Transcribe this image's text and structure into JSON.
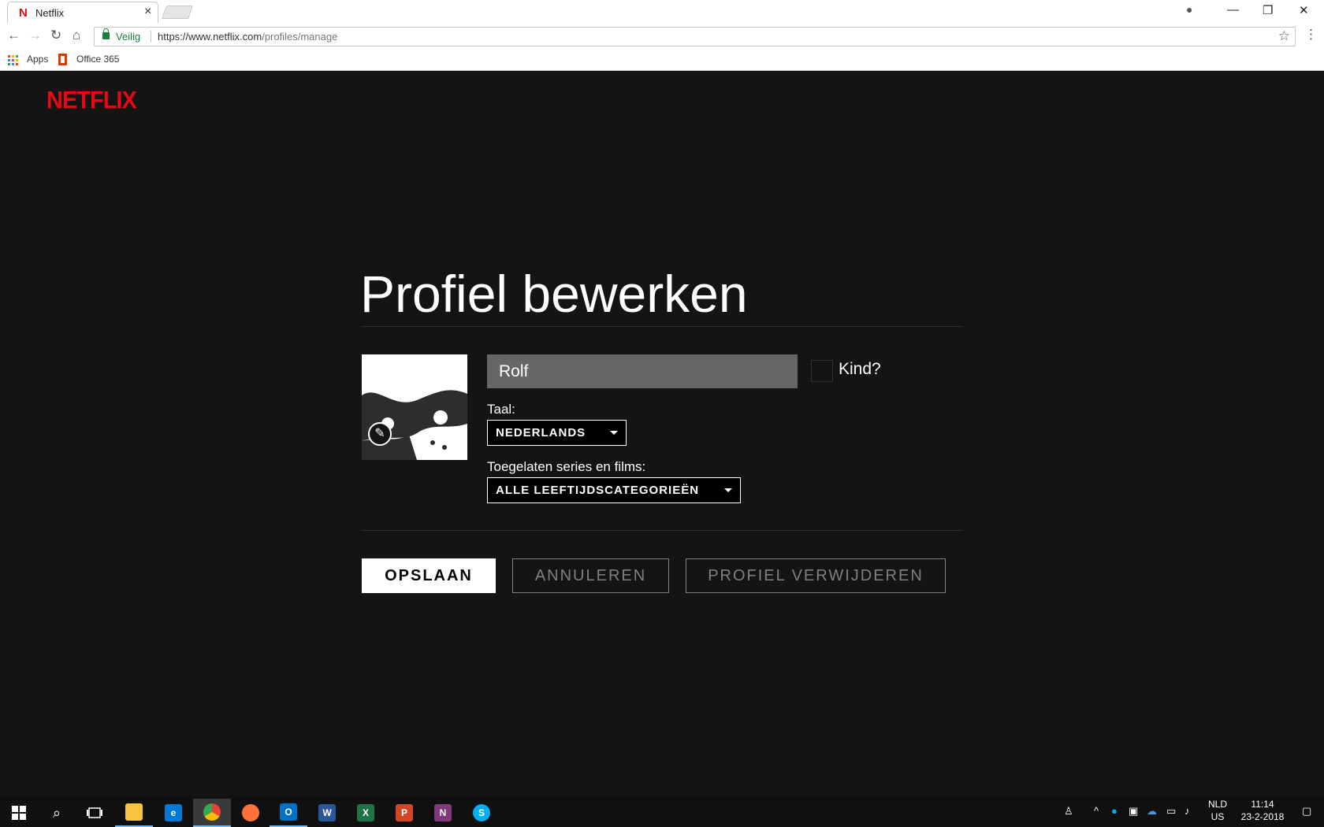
{
  "browser": {
    "tab_title": "Netflix",
    "tab_favicon": "N",
    "security_label": "Veilig",
    "url_host": "https://www.netflix.com",
    "url_path": "/profiles/manage",
    "bookmarks": [
      {
        "label": "Apps",
        "icon": "apps-grid-icon"
      },
      {
        "label": "Office 365",
        "icon": "office365-icon"
      }
    ]
  },
  "netflix": {
    "logo": "NETFLIX",
    "page_title": "Profiel bewerken",
    "profile_name": "Rolf",
    "kid_label": "Kind?",
    "kid_checked": false,
    "language_label": "Taal:",
    "language_value": "NEDERLANDS",
    "maturity_label": "Toegelaten series en films:",
    "maturity_value": "ALLE LEEFTIJDSCATEGORIEËN",
    "save_button": "OPSLAAN",
    "cancel_button": "ANNULEREN",
    "delete_button": "PROFIEL VERWIJDEREN",
    "brand_color": "#e50914"
  },
  "taskbar": {
    "apps": [
      "windows-start-icon",
      "search-icon",
      "task-view-icon",
      "file-explorer-icon",
      "edge-icon",
      "chrome-icon",
      "firefox-icon",
      "outlook-icon",
      "word-icon",
      "excel-icon",
      "powerpoint-icon",
      "onenote-icon",
      "skype-icon"
    ],
    "lang_line1": "NLD",
    "lang_line2": "US",
    "time": "11:14",
    "date": "23-2-2018"
  }
}
